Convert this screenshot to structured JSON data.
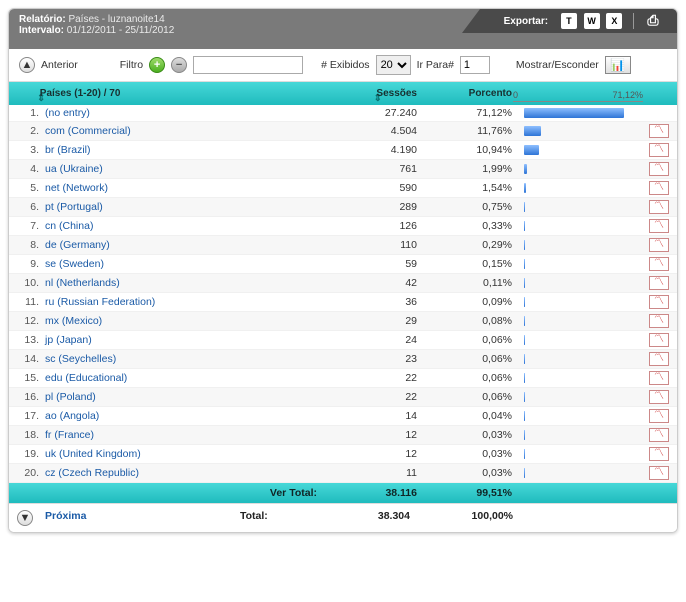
{
  "header": {
    "report_label": "Relatório:",
    "report_value": "Países - luznanoite14",
    "interval_label": "Intervalo:",
    "interval_value": "01/12/2011 - 25/11/2012",
    "export_label": "Exportar:",
    "icons": {
      "txt": "T",
      "word": "W",
      "excel": "X"
    }
  },
  "toolbar": {
    "prev": "Anterior",
    "filter_label": "Filtro",
    "filter_value": "",
    "num_shown_label": "# Exibidos",
    "num_shown_value": "20",
    "goto_label": "Ir Para#",
    "goto_value": "1",
    "show_hide": "Mostrar/Esconder"
  },
  "columns": {
    "country": "Países  (1-20) / 70",
    "sessions": "Sessões",
    "percent": "Porcento",
    "scale_min": "0",
    "scale_max": "71,12%"
  },
  "max_pct": 71.12,
  "rows": [
    {
      "n": "1.",
      "name": "(no entry)",
      "sessions": "27.240",
      "pct": "71,12%",
      "pv": 71.12,
      "chart": false
    },
    {
      "n": "2.",
      "name": "com (Commercial)",
      "sessions": "4.504",
      "pct": "11,76%",
      "pv": 11.76,
      "chart": true
    },
    {
      "n": "3.",
      "name": "br (Brazil)",
      "sessions": "4.190",
      "pct": "10,94%",
      "pv": 10.94,
      "chart": true
    },
    {
      "n": "4.",
      "name": "ua (Ukraine)",
      "sessions": "761",
      "pct": "1,99%",
      "pv": 1.99,
      "chart": true
    },
    {
      "n": "5.",
      "name": "net (Network)",
      "sessions": "590",
      "pct": "1,54%",
      "pv": 1.54,
      "chart": true
    },
    {
      "n": "6.",
      "name": "pt (Portugal)",
      "sessions": "289",
      "pct": "0,75%",
      "pv": 0.75,
      "chart": true
    },
    {
      "n": "7.",
      "name": "cn (China)",
      "sessions": "126",
      "pct": "0,33%",
      "pv": 0.33,
      "chart": true
    },
    {
      "n": "8.",
      "name": "de (Germany)",
      "sessions": "110",
      "pct": "0,29%",
      "pv": 0.29,
      "chart": true
    },
    {
      "n": "9.",
      "name": "se (Sweden)",
      "sessions": "59",
      "pct": "0,15%",
      "pv": 0.15,
      "chart": true
    },
    {
      "n": "10.",
      "name": "nl (Netherlands)",
      "sessions": "42",
      "pct": "0,11%",
      "pv": 0.11,
      "chart": true
    },
    {
      "n": "11.",
      "name": "ru (Russian Federation)",
      "sessions": "36",
      "pct": "0,09%",
      "pv": 0.09,
      "chart": true
    },
    {
      "n": "12.",
      "name": "mx (Mexico)",
      "sessions": "29",
      "pct": "0,08%",
      "pv": 0.08,
      "chart": true
    },
    {
      "n": "13.",
      "name": "jp (Japan)",
      "sessions": "24",
      "pct": "0,06%",
      "pv": 0.06,
      "chart": true
    },
    {
      "n": "14.",
      "name": "sc (Seychelles)",
      "sessions": "23",
      "pct": "0,06%",
      "pv": 0.06,
      "chart": true
    },
    {
      "n": "15.",
      "name": "edu (Educational)",
      "sessions": "22",
      "pct": "0,06%",
      "pv": 0.06,
      "chart": true
    },
    {
      "n": "16.",
      "name": "pl (Poland)",
      "sessions": "22",
      "pct": "0,06%",
      "pv": 0.06,
      "chart": true
    },
    {
      "n": "17.",
      "name": "ao (Angola)",
      "sessions": "14",
      "pct": "0,04%",
      "pv": 0.04,
      "chart": true
    },
    {
      "n": "18.",
      "name": "fr (France)",
      "sessions": "12",
      "pct": "0,03%",
      "pv": 0.03,
      "chart": true
    },
    {
      "n": "19.",
      "name": "uk (United Kingdom)",
      "sessions": "12",
      "pct": "0,03%",
      "pv": 0.03,
      "chart": true
    },
    {
      "n": "20.",
      "name": "cz (Czech Republic)",
      "sessions": "11",
      "pct": "0,03%",
      "pv": 0.03,
      "chart": true
    }
  ],
  "subtotal": {
    "label": "Ver Total:",
    "sessions": "38.116",
    "pct": "99,51%"
  },
  "total": {
    "label": "Total:",
    "sessions": "38.304",
    "pct": "100,00%"
  },
  "nav": {
    "next": "Próxima"
  },
  "chart_data": {
    "type": "bar",
    "title": "Países (1-20) / 70",
    "xlabel": "",
    "ylabel": "Porcento",
    "ylim": [
      0,
      71.12
    ],
    "categories": [
      "(no entry)",
      "com (Commercial)",
      "br (Brazil)",
      "ua (Ukraine)",
      "net (Network)",
      "pt (Portugal)",
      "cn (China)",
      "de (Germany)",
      "se (Sweden)",
      "nl (Netherlands)",
      "ru (Russian Federation)",
      "mx (Mexico)",
      "jp (Japan)",
      "sc (Seychelles)",
      "edu (Educational)",
      "pl (Poland)",
      "ao (Angola)",
      "fr (France)",
      "uk (United Kingdom)",
      "cz (Czech Republic)"
    ],
    "series": [
      {
        "name": "Sessões",
        "values": [
          27240,
          4504,
          4190,
          761,
          590,
          289,
          126,
          110,
          59,
          42,
          36,
          29,
          24,
          23,
          22,
          22,
          14,
          12,
          12,
          11
        ]
      },
      {
        "name": "Porcento",
        "values": [
          71.12,
          11.76,
          10.94,
          1.99,
          1.54,
          0.75,
          0.33,
          0.29,
          0.15,
          0.11,
          0.09,
          0.08,
          0.06,
          0.06,
          0.06,
          0.06,
          0.04,
          0.03,
          0.03,
          0.03
        ]
      }
    ]
  }
}
